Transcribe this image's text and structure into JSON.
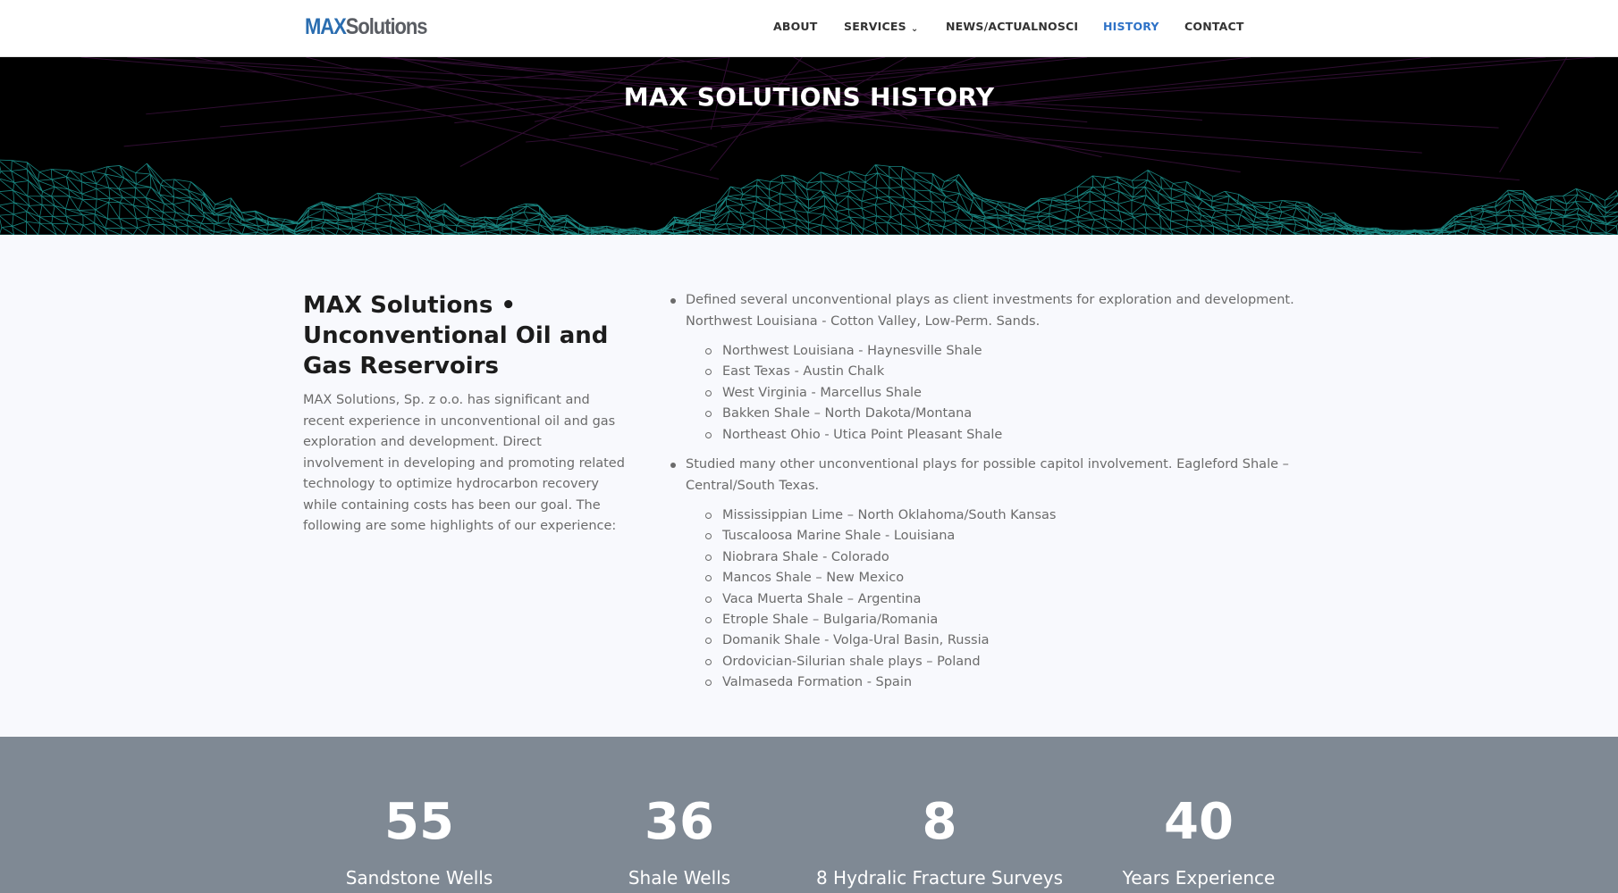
{
  "header": {
    "logo": {
      "max": "MAX",
      "solutions": "Solutions"
    },
    "nav": [
      {
        "label": "ABOUT"
      },
      {
        "label": "SERVICES",
        "has_dropdown": true
      },
      {
        "label": "NEWS/ACTUALNOSCI"
      },
      {
        "label": "HISTORY",
        "active": true
      },
      {
        "label": "CONTACT"
      }
    ]
  },
  "banner": {
    "title": "MAX SOLUTIONS HISTORY"
  },
  "intro": {
    "heading": "MAX Solutions • Unconventional Oil and Gas Reservoirs",
    "text": "MAX Solutions, Sp. z o.o. has significant and recent experience in unconventional oil and gas exploration and development. Direct involvement in developing and promoting related technology to optimize hydrocarbon recovery while containing costs has been our goal. The following are some highlights of our experience:"
  },
  "highlights": [
    {
      "text": "Defined several unconventional plays as client investments for exploration and development. Northwest Louisiana - Cotton Valley, Low-Perm. Sands.",
      "items": [
        "Northwest Louisiana - Haynesville Shale",
        "East Texas - Austin Chalk",
        "West Virginia - Marcellus Shale",
        "Bakken Shale – North Dakota/Montana",
        "Northeast Ohio - Utica Point Pleasant Shale"
      ]
    },
    {
      "text": "Studied many other unconventional plays for possible capitol involvement. Eagleford Shale – Central/South Texas.",
      "items": [
        "Mississippian Lime – North Oklahoma/South Kansas",
        "Tuscaloosa Marine Shale - Louisiana",
        "Niobrara Shale - Colorado",
        "Mancos Shale – New Mexico",
        "Vaca Muerta Shale – Argentina",
        "Etrople Shale – Bulgaria/Romania",
        "Domanik Shale - Volga-Ural Basin, Russia",
        "Ordovician-Silurian shale plays – Poland",
        "Valmaseda Formation - Spain"
      ]
    }
  ],
  "stats": [
    {
      "number": "55",
      "label": "Sandstone Wells"
    },
    {
      "number": "36",
      "label": "Shale Wells"
    },
    {
      "number": "8",
      "label": "8 Hydralic Fracture Surveys"
    },
    {
      "number": "40",
      "label": "Years Experience"
    }
  ],
  "colors": {
    "brand_blue": "#2a6db0",
    "nav_active": "#2e72c7",
    "banner_bg": "#000000",
    "wireframe": "#1fa6a0",
    "stats_bg": "#7f8994"
  }
}
